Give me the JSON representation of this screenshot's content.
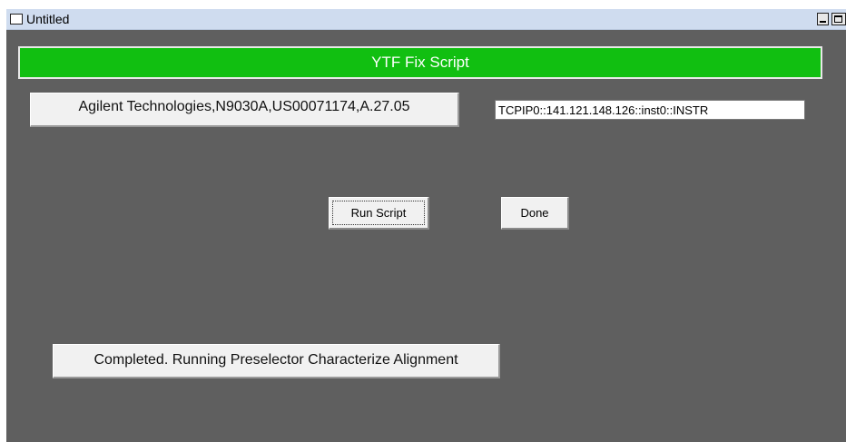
{
  "window": {
    "title": "Untitled"
  },
  "header": {
    "title": "YTF Fix Script",
    "color": "#11bf11"
  },
  "instrument": {
    "id_string": "Agilent Technologies,N9030A,US00071174,A.27.05",
    "address": "TCPIP0::141.121.148.126::inst0::INSTR"
  },
  "buttons": {
    "run_label": "Run Script",
    "done_label": "Done"
  },
  "status": {
    "message": "Completed.  Running Preselector Characterize Alignment"
  },
  "icons": {
    "window": "window-icon",
    "minimize": "minimize-icon",
    "maximize": "maximize-icon"
  }
}
